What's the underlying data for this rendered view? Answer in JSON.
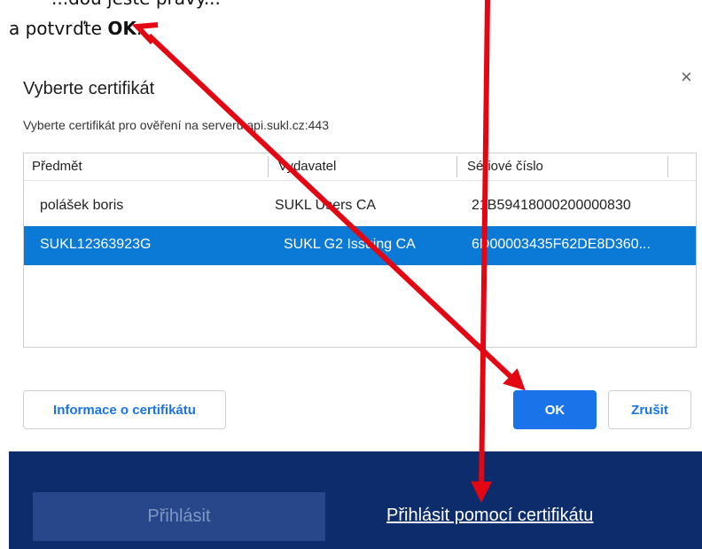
{
  "instruction": {
    "line1": "...dou jeste pravý...",
    "line2_prefix": "a potvrďte ",
    "line2_bold": "OK",
    "line2_suffix": "."
  },
  "dialog": {
    "title": "Vyberte certifikát",
    "subtitle": "Vyberte certifikát pro ověření na serveru api.sukl.cz:443",
    "close_icon": "×",
    "columns": [
      "Předmět",
      "Vydavatel",
      "Sériové číslo"
    ],
    "rows": [
      {
        "subject": "polášek boris",
        "issuer": "SUKL Users CA",
        "serial": "21B59418000200000830",
        "selected": false
      },
      {
        "subject": "SUKL12363923G",
        "issuer": "SUKL G2 Issuing CA",
        "serial": "6D00003435F62DE8D360...",
        "selected": true
      }
    ],
    "info_button": "Informace o certifikátu",
    "ok_button": "OK",
    "cancel_button": "Zrušit"
  },
  "banner": {
    "login_button": "Přihlásit",
    "cert_link": "Přihlásit pomocí certifikátu"
  },
  "colors": {
    "arrow": "#e30613",
    "selected_row": "#0b79d6",
    "primary": "#1a73e8",
    "banner": "#0d2c6c"
  }
}
